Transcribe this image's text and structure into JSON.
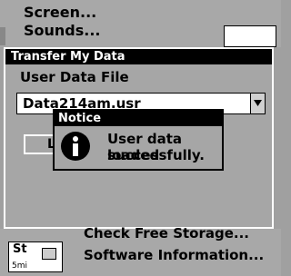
{
  "background_menu": {
    "screen_label": "Screen...",
    "sounds_label": "Sounds..."
  },
  "dialog": {
    "title": "Transfer My Data",
    "user_data_label": "User Data File",
    "file_value": "Data214am.usr",
    "partial_button_label": "L"
  },
  "notice": {
    "title": "Notice",
    "message_line1": "User data loaded",
    "message_line2": "successfully.",
    "icon": "info-icon"
  },
  "bottom_menu": {
    "item1": "Check Free Storage...",
    "item2": "Software Information..."
  },
  "mini_map": {
    "label": "St",
    "scale": "5mi"
  }
}
